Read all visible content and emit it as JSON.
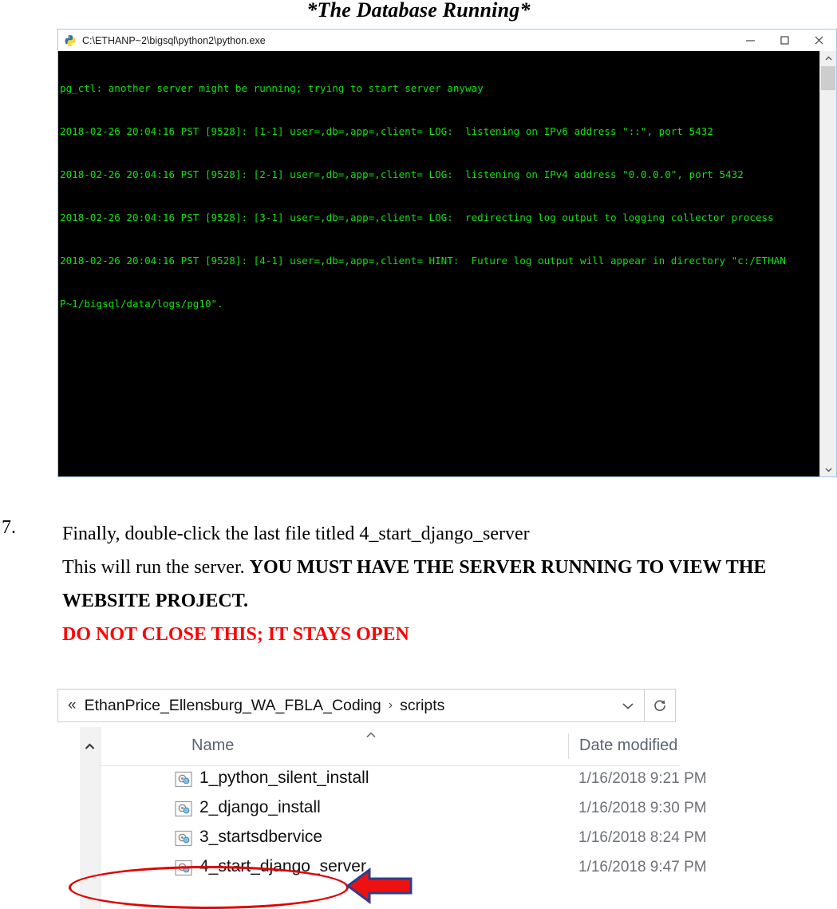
{
  "document": {
    "heading": "*The Database Running*"
  },
  "terminal": {
    "title": "C:\\ETHANP~2\\bigsql\\python2\\python.exe",
    "icon": "python-icon",
    "controls": [
      {
        "name": "minimize-button",
        "label": "—"
      },
      {
        "name": "maximize-button",
        "label": "□"
      },
      {
        "name": "close-button",
        "label": "✕"
      }
    ],
    "text_color": "#12e012",
    "background": "#000000",
    "lines": [
      "pg_ctl: another server might be running; trying to start server anyway",
      "2018-02-26 20:04:16 PST [9528]: [1-1] user=,db=,app=,client= LOG:  listening on IPv6 address \"::\", port 5432",
      "2018-02-26 20:04:16 PST [9528]: [2-1] user=,db=,app=,client= LOG:  listening on IPv4 address \"0.0.0.0\", port 5432",
      "2018-02-26 20:04:16 PST [9528]: [3-1] user=,db=,app=,client= LOG:  redirecting log output to logging collector process",
      "2018-02-26 20:04:16 PST [9528]: [4-1] user=,db=,app=,client= HINT:  Future log output will appear in directory \"c:/ETHANP~1/bigsql/data/logs/pg10\"."
    ],
    "lines_wrapped": [
      "pg_ctl: another server might be running; trying to start server anyway",
      "2018-02-26 20:04:16 PST [9528]: [1-1] user=,db=,app=,client= LOG:  listening on IPv6 address \"::\", port 5432",
      "2018-02-26 20:04:16 PST [9528]: [2-1] user=,db=,app=,client= LOG:  listening on IPv4 address \"0.0.0.0\", port 5432",
      "2018-02-26 20:04:16 PST [9528]: [3-1] user=,db=,app=,client= LOG:  redirecting log output to logging collector process",
      "2018-02-26 20:04:16 PST [9528]: [4-1] user=,db=,app=,client= HINT:  Future log output will appear in directory \"c:/ETHAN",
      "P~1/bigsql/data/logs/pg10\"."
    ]
  },
  "instruction": {
    "number": "7.",
    "part1": "Finally, double-click the last file titled 4_start_django_server",
    "part2": "This will run the server. ",
    "part2_bold": "YOU MUST HAVE THE SERVER RUNNING TO VIEW THE WEBSITE PROJECT.",
    "part3_red": "DO NOT CLOSE THIS; IT STAYS OPEN"
  },
  "explorer": {
    "address_bar": {
      "back_icon": "double-chevron-left-icon",
      "back_label": "«",
      "crumbs": [
        "EthanPrice_Ellensburg_WA_FBLA_Coding",
        "scripts"
      ],
      "separator": "›",
      "dropdown_icon": "chevron-down-icon",
      "refresh_icon": "refresh-icon"
    },
    "nav_collapse_icon": "chevron-up-icon",
    "columns": [
      {
        "label": "Name",
        "sort_icon": "sort-ascending-icon"
      },
      {
        "label": "Date modified"
      }
    ],
    "files": [
      {
        "icon": "batch-script-icon",
        "name": "1_python_silent_install",
        "date": "1/16/2018 9:21 PM"
      },
      {
        "icon": "batch-script-icon",
        "name": "2_django_install",
        "date": "1/16/2018 9:30 PM"
      },
      {
        "icon": "batch-script-icon",
        "name": "3_startsdbervice",
        "date": "1/16/2018 8:24 PM"
      },
      {
        "icon": "batch-script-icon",
        "name": "4_start_django_server",
        "date": "1/16/2018 9:47 PM"
      }
    ]
  },
  "annotations": {
    "ellipse": {
      "name": "highlight-ellipse",
      "color": "#e00000",
      "target": "4_start_django_server"
    },
    "arrow": {
      "name": "pointer-arrow",
      "fill": "#ee1111",
      "stroke": "#2b3f8c",
      "direction": "left"
    }
  }
}
